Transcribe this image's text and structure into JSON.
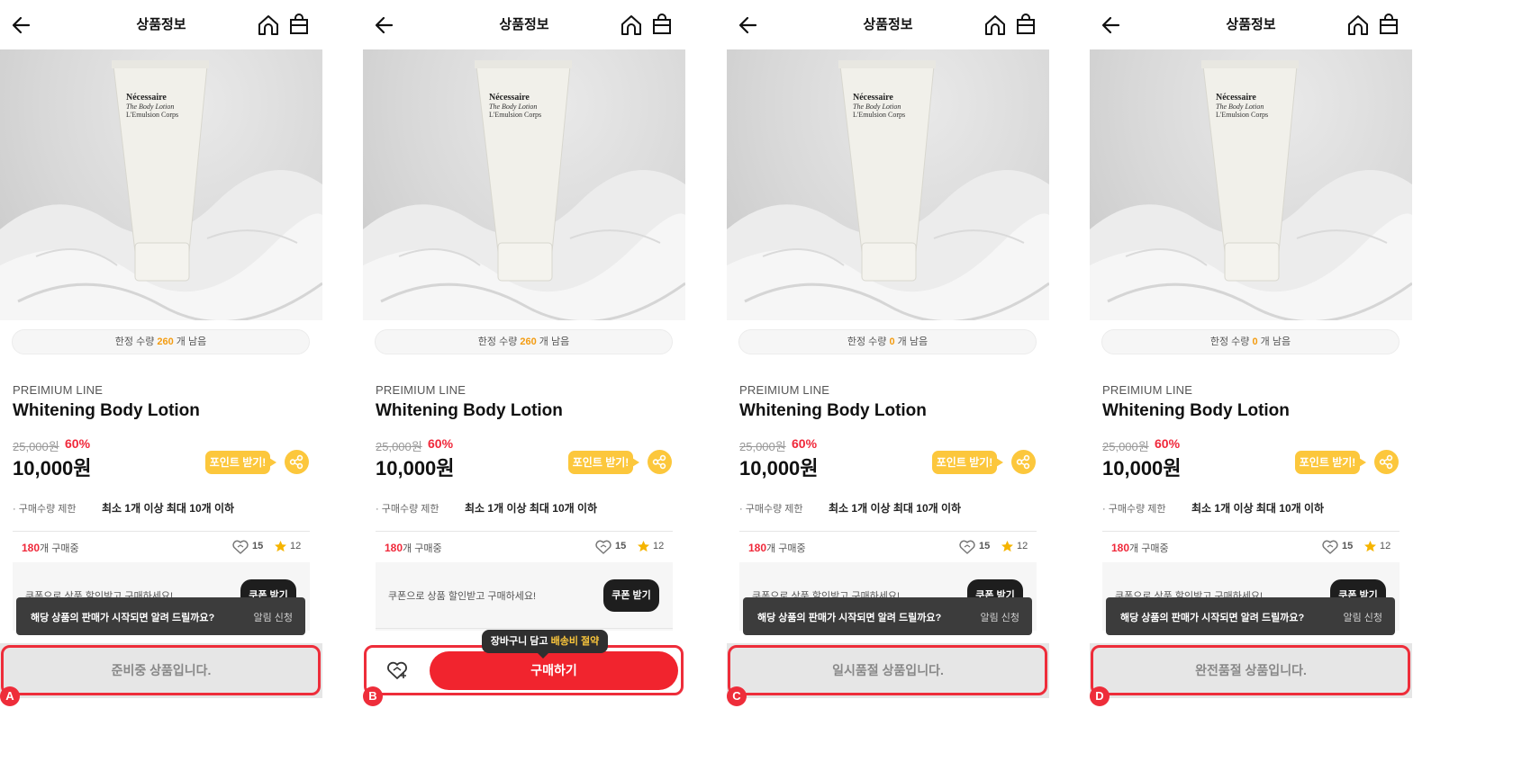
{
  "header": {
    "title": "상품정보"
  },
  "product": {
    "brand": "PREIMIUM LINE",
    "name": "Whitening Body Lotion",
    "original_price": "25,000원",
    "discount": "60%",
    "price": "10,000원",
    "tube_text": [
      "Nécessaire",
      "The Body Lotion",
      "L'Emulsion Corps"
    ]
  },
  "point_button": "포인트 받기!",
  "purchase_limit": {
    "label": "· 구매수량 제한",
    "value": "최소 1개 이상 최대 10개 이하"
  },
  "stats": {
    "buying_count": "180",
    "buying_suffix": "개 구매중",
    "likes": "15",
    "rating": "12"
  },
  "coupon": {
    "text": "쿠폰으로 상품 할인받고 구매하세요!",
    "button": "쿠폰 받기"
  },
  "toast": {
    "text": "해당 상품의 판매가 시작되면 알려 드릴까요?",
    "action": "알림 신청"
  },
  "cart_tip": {
    "prefix": "장바구니 담고 ",
    "highlight": "배송비 절약"
  },
  "variants": [
    {
      "marker": "A",
      "stock_prefix": "한정 수량 ",
      "stock": "260",
      "stock_suffix": " 개 남음",
      "status": "준비중 상품입니다."
    },
    {
      "marker": "B",
      "stock_prefix": "한정 수량 ",
      "stock": "260",
      "stock_suffix": " 개 남음",
      "buy_label": "구매하기"
    },
    {
      "marker": "C",
      "stock_prefix": "한정 수량 ",
      "stock": "0",
      "stock_suffix": " 개 남음",
      "status": "일시품절 상품입니다."
    },
    {
      "marker": "D",
      "stock_prefix": "한정 수량 ",
      "stock": "0",
      "stock_suffix": " 개 남음",
      "status": "완전품절 상품입니다."
    }
  ],
  "colors": {
    "accent_red": "#ee2d3a",
    "point_yellow": "#fcc73c",
    "stock_orange": "#f39c12"
  }
}
